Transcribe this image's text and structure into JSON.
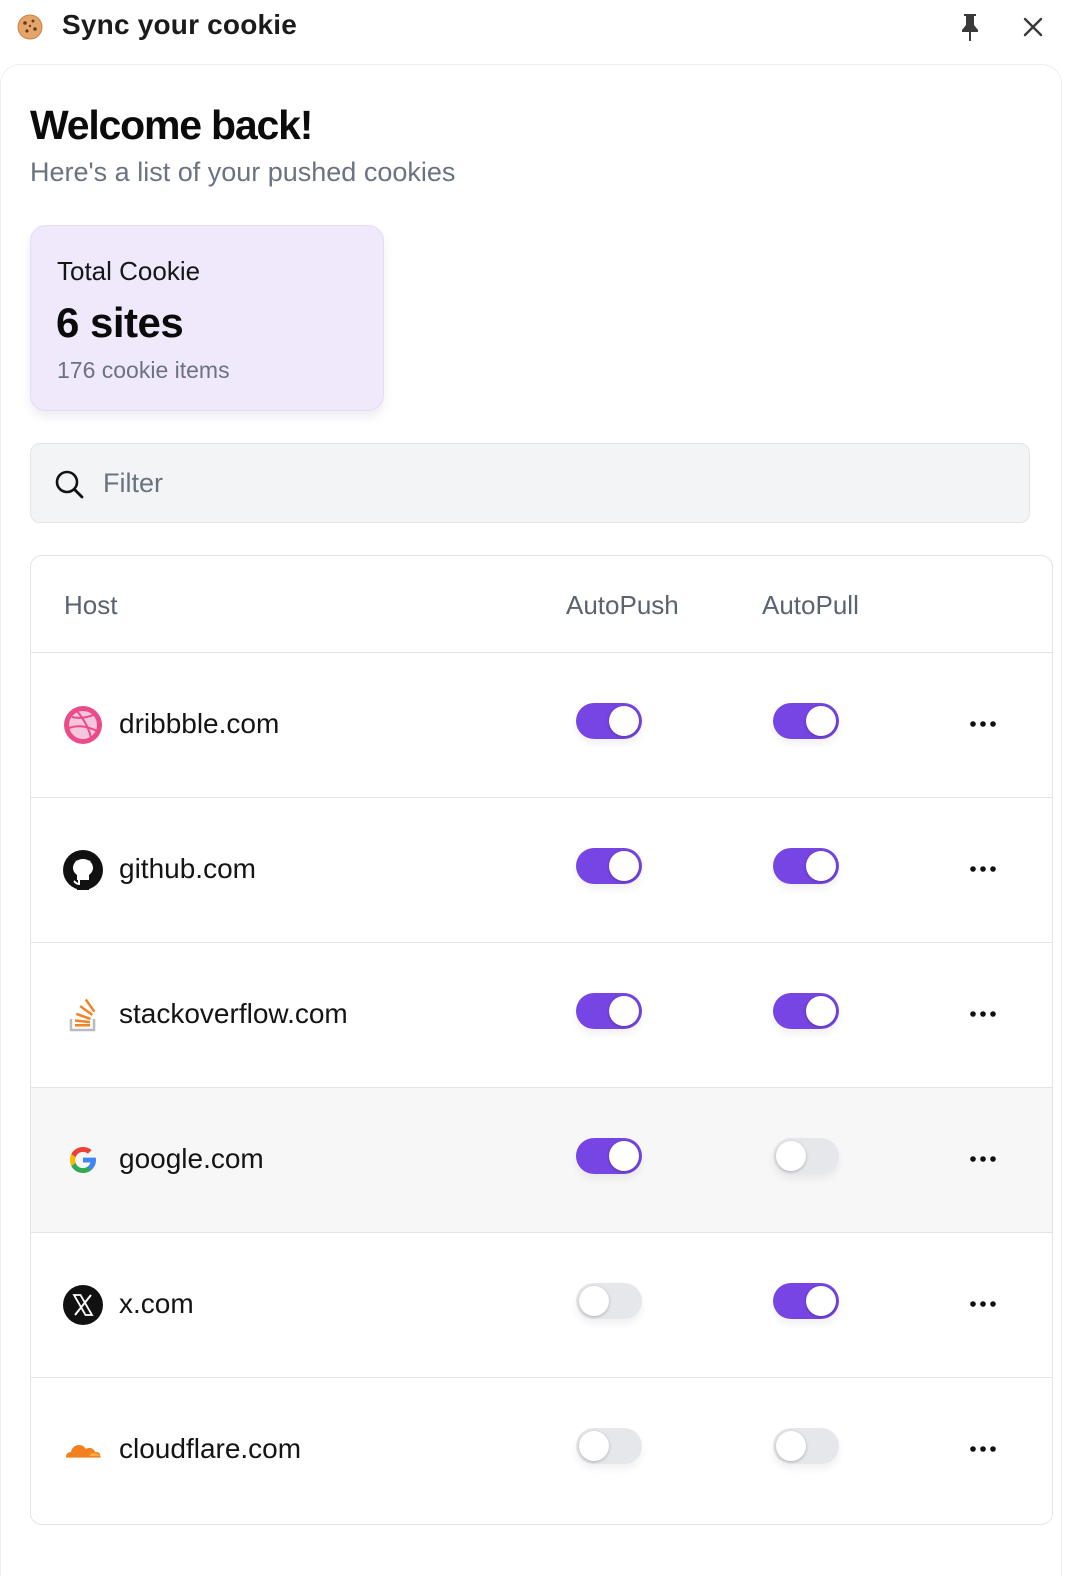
{
  "titlebar": {
    "title": "Sync your cookie",
    "icons": {
      "logo": "cookie-icon",
      "pin": "pin-icon",
      "close": "close-icon"
    }
  },
  "header": {
    "welcome": "Welcome back!",
    "subtitle": "Here's a list of your pushed cookies"
  },
  "stats": {
    "label": "Total Cookie",
    "value": "6 sites",
    "sub": "176 cookie items"
  },
  "filter": {
    "placeholder": "Filter",
    "value": ""
  },
  "table": {
    "columns": {
      "host": "Host",
      "autopush": "AutoPush",
      "autopull": "AutoPull"
    },
    "rows": [
      {
        "host": "dribbble.com",
        "icon": "dribbble-icon",
        "autopush": true,
        "autopull": true
      },
      {
        "host": "github.com",
        "icon": "github-icon",
        "autopush": true,
        "autopull": true
      },
      {
        "host": "stackoverflow.com",
        "icon": "stackoverflow-icon",
        "autopush": true,
        "autopull": true
      },
      {
        "host": "google.com",
        "icon": "google-icon",
        "autopush": true,
        "autopull": false
      },
      {
        "host": "x.com",
        "icon": "x-icon",
        "autopush": false,
        "autopull": true
      },
      {
        "host": "cloudflare.com",
        "icon": "cloudflare-icon",
        "autopush": false,
        "autopull": false
      }
    ]
  },
  "colors": {
    "accent": "#7645e4",
    "toggle_off": "#e5e7eb",
    "card_bg": "#efe9fb",
    "muted_text": "#6b7280"
  }
}
